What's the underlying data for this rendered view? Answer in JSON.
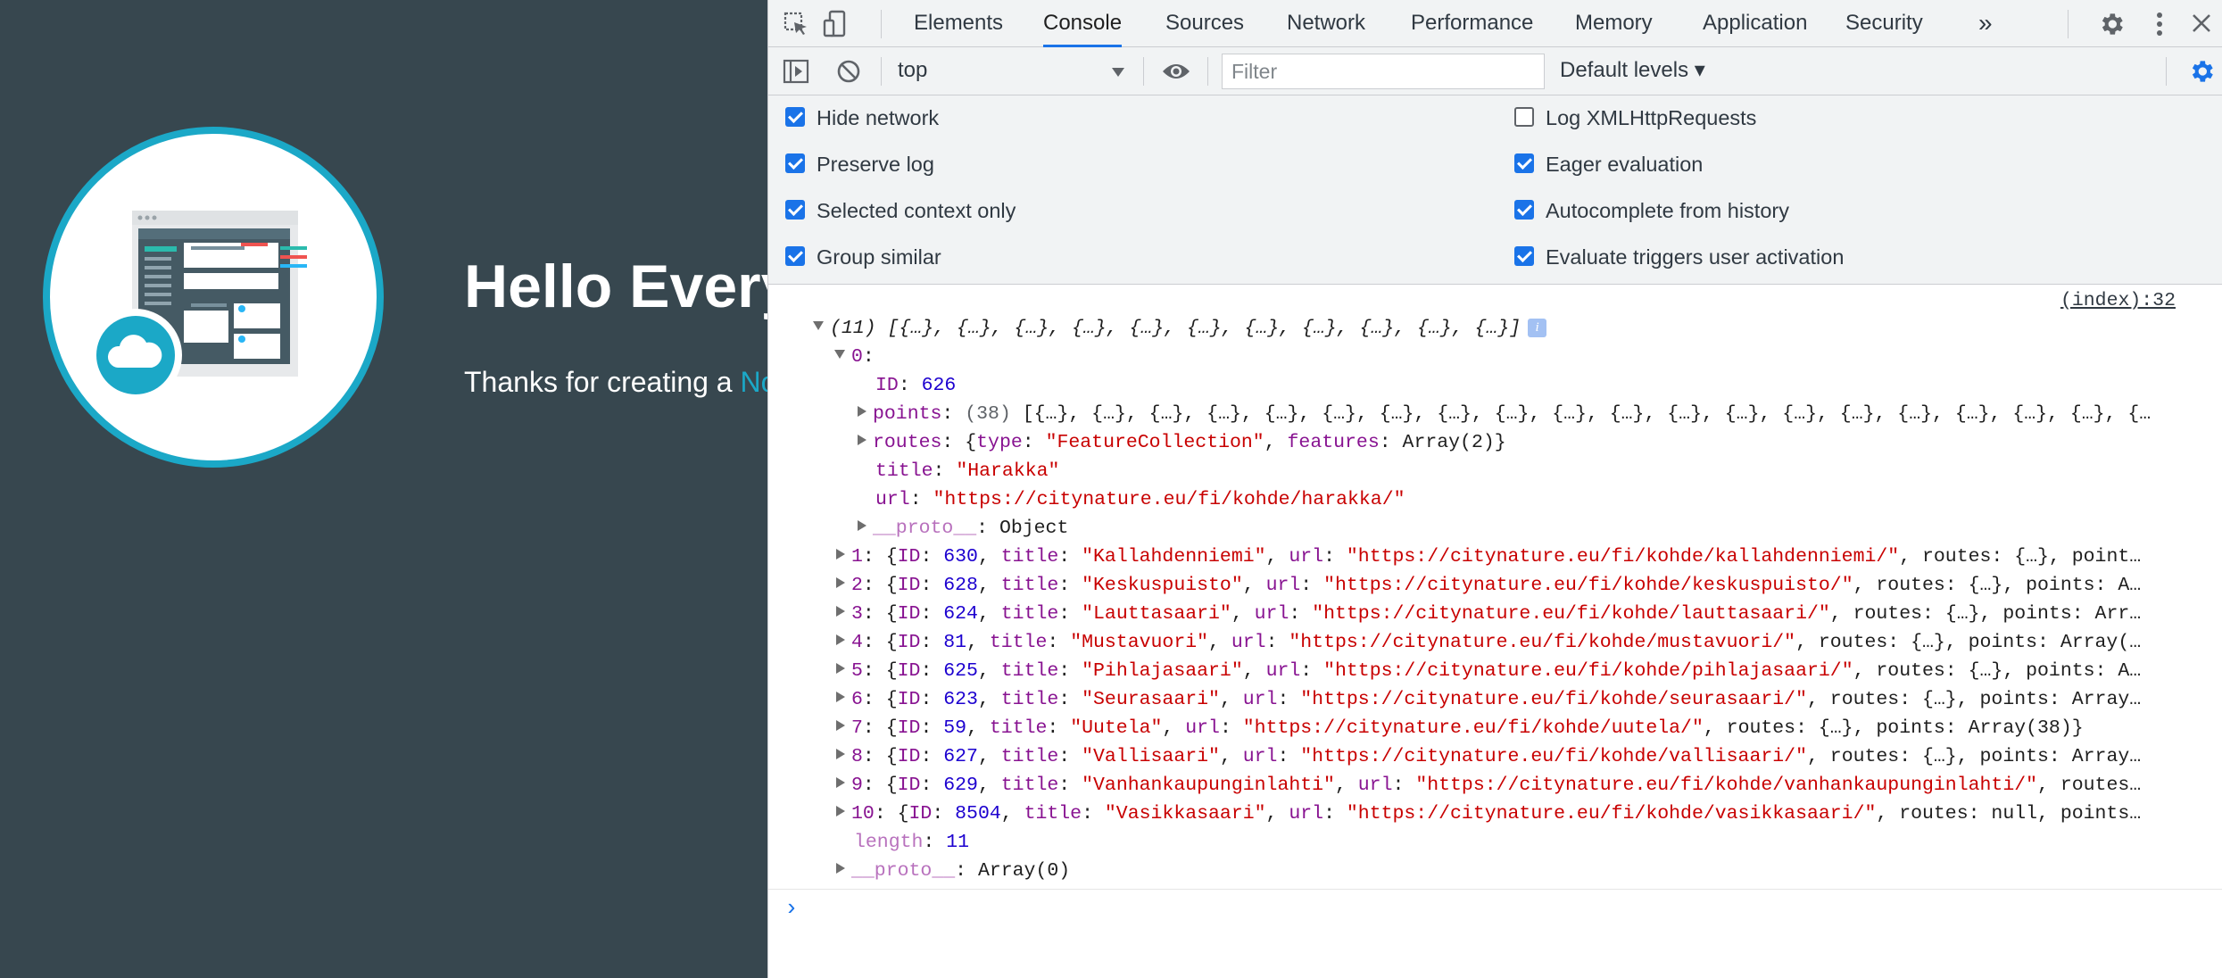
{
  "page": {
    "hero_title": "Hello Every",
    "hero_text_before": "Thanks for creating a ",
    "hero_link": "No"
  },
  "devtools": {
    "tabs": [
      {
        "label": "Elements"
      },
      {
        "label": "Console"
      },
      {
        "label": "Sources"
      },
      {
        "label": "Network"
      },
      {
        "label": "Performance"
      },
      {
        "label": "Memory"
      },
      {
        "label": "Application"
      },
      {
        "label": "Security"
      }
    ],
    "more_tabs_glyph": "»",
    "active_tab": "Console",
    "context": "top",
    "filter_placeholder": "Filter",
    "levels": "Default levels ▾",
    "settings": [
      {
        "label": "Hide network",
        "checked": true
      },
      {
        "label": "Preserve log",
        "checked": true
      },
      {
        "label": "Selected context only",
        "checked": true
      },
      {
        "label": "Group similar",
        "checked": true
      },
      {
        "label": "Log XMLHttpRequests",
        "checked": false
      },
      {
        "label": "Eager evaluation",
        "checked": true
      },
      {
        "label": "Autocomplete from history",
        "checked": true
      },
      {
        "label": "Evaluate triggers user activation",
        "checked": true
      }
    ]
  },
  "console": {
    "source": "(index):32",
    "summary": "(11) [{…}, {…}, {…}, {…}, {…}, {…}, {…}, {…}, {…}, {…}, {…}]",
    "item0": {
      "index": "0",
      "id": "626",
      "points_count": "(38)",
      "points_preview": "[{…}, {…}, {…}, {…}, {…}, {…}, {…}, {…}, {…}, {…}, {…}, {…}, {…}, {…}, {…}, {…}, {…}, {…}, {…}, {…",
      "routes_type": "\"FeatureCollection\"",
      "routes_features": "Array(2)",
      "title": "\"Harakka\"",
      "url": "\"https://citynature.eu/fi/kohde/harakka/\"",
      "proto": "Object"
    },
    "rows": [
      {
        "index": "1",
        "id": "630",
        "title": "\"Kallahdenniemi\"",
        "url": "\"https://citynature.eu/fi/kohde/kallahdenniemi/\"",
        "rest": ", routes: {…}, point…"
      },
      {
        "index": "2",
        "id": "628",
        "title": "\"Keskuspuisto\"",
        "url": "\"https://citynature.eu/fi/kohde/keskuspuisto/\"",
        "rest": ", routes: {…}, points: A…"
      },
      {
        "index": "3",
        "id": "624",
        "title": "\"Lauttasaari\"",
        "url": "\"https://citynature.eu/fi/kohde/lauttasaari/\"",
        "rest": ", routes: {…}, points: Arr…"
      },
      {
        "index": "4",
        "id": "81",
        "title": "\"Mustavuori\"",
        "url": "\"https://citynature.eu/fi/kohde/mustavuori/\"",
        "rest": ", routes: {…}, points: Array(…"
      },
      {
        "index": "5",
        "id": "625",
        "title": "\"Pihlajasaari\"",
        "url": "\"https://citynature.eu/fi/kohde/pihlajasaari/\"",
        "rest": ", routes: {…}, points: A…"
      },
      {
        "index": "6",
        "id": "623",
        "title": "\"Seurasaari\"",
        "url": "\"https://citynature.eu/fi/kohde/seurasaari/\"",
        "rest": ", routes: {…}, points: Array…"
      },
      {
        "index": "7",
        "id": "59",
        "title": "\"Uutela\"",
        "url": "\"https://citynature.eu/fi/kohde/uutela/\"",
        "rest": ", routes: {…}, points: Array(38)}"
      },
      {
        "index": "8",
        "id": "627",
        "title": "\"Vallisaari\"",
        "url": "\"https://citynature.eu/fi/kohde/vallisaari/\"",
        "rest": ", routes: {…}, points: Array…"
      },
      {
        "index": "9",
        "id": "629",
        "title": "\"Vanhankaupunginlahti\"",
        "url": "\"https://citynature.eu/fi/kohde/vanhankaupunginlahti/\"",
        "rest": ", routes…"
      },
      {
        "index": "10",
        "id": "8504",
        "title": "\"Vasikkasaari\"",
        "url": "\"https://citynature.eu/fi/kohde/vasikkasaari/\"",
        "rest": ", routes: null, points…"
      }
    ],
    "length": "11",
    "array_proto": "Array(0)",
    "prompt": "›"
  },
  "colors": {
    "page_bg": "#37474f",
    "accent": "#1ba8c7",
    "devtools_blue": "#1a73e8",
    "key_purple": "#881391",
    "string_red": "#c80000",
    "number_blue": "#1c00cf"
  }
}
